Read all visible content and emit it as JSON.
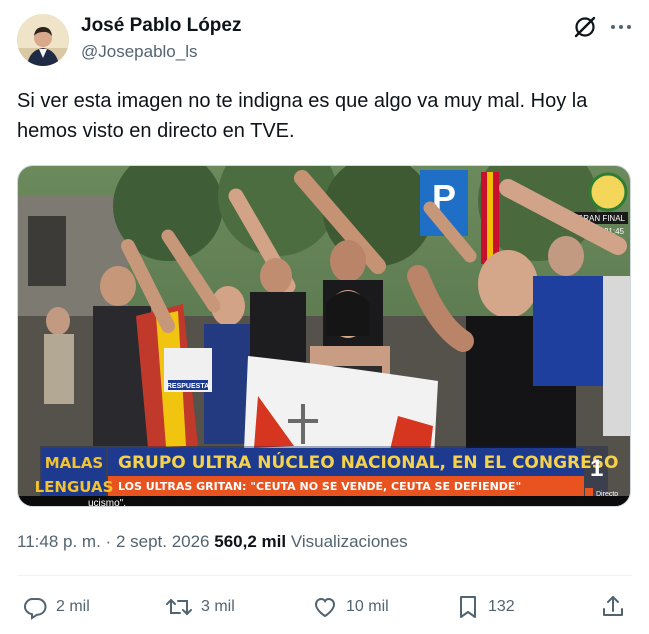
{
  "author": {
    "name": "José Pablo López",
    "handle": "@Josepablo_ls"
  },
  "tweet": {
    "text": "Si ver esta imagen no te indigna es que algo va muy mal. Hoy la hemos visto en directo en TVE."
  },
  "media": {
    "show_logo_line1": "MALAS",
    "show_logo_line2": "LENGUAS",
    "headline": "GRUPO ULTRA NÚCLEO NACIONAL, EN EL CONGRESO",
    "subheadline": "LOS ULTRAS GRITAN: \"CEUTA NO SE VENDE, CEUTA SE DEFIENDE\"",
    "ticker": "ucismo\".",
    "channel": "1",
    "live_label": "Directo",
    "corner_badge": "GRAN FINAL",
    "corner_time": "21:45",
    "sign_text": "RESPUESTA",
    "parking_letter": "P"
  },
  "meta": {
    "time": "11:48 p. m.",
    "separator": "·",
    "date": "2 sept. 2026",
    "views_count": "560,2 mil",
    "views_label": "Visualizaciones"
  },
  "actions": {
    "replies": "2 mil",
    "reposts": "3 mil",
    "likes": "10 mil",
    "bookmarks": "132"
  },
  "icons": [
    "grok-icon",
    "more-icon",
    "reply-icon",
    "repost-icon",
    "like-icon",
    "bookmark-icon",
    "share-icon"
  ],
  "colors": {
    "text": "#0f1419",
    "secondary": "#536471",
    "banner_blue": "#1d3a8f",
    "banner_orange": "#e8531f",
    "logo_yellow": "#f2c230"
  }
}
